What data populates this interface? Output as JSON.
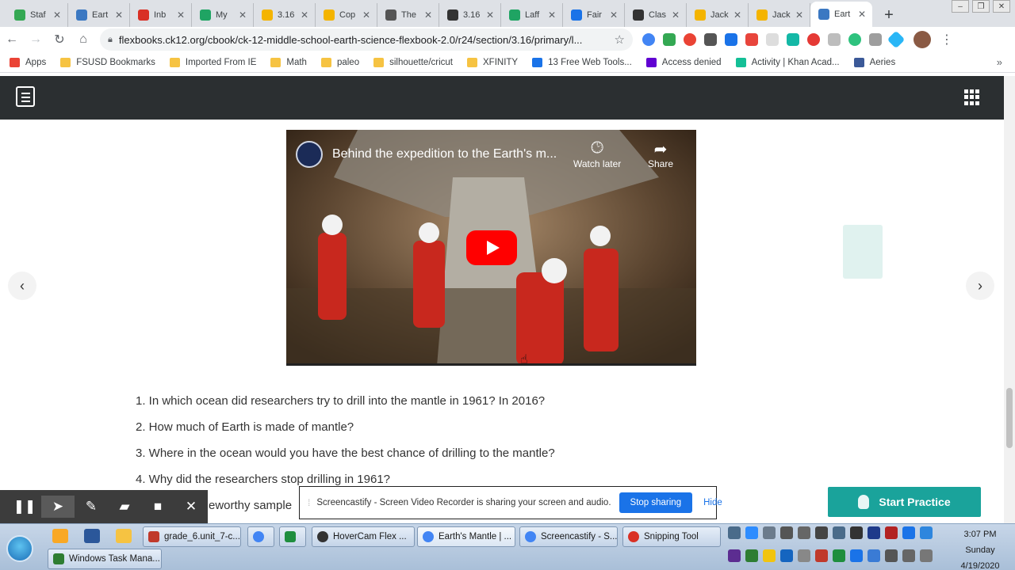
{
  "tabs": [
    {
      "label": "Staf",
      "icon": "green-dot-icon",
      "color": "#34a853"
    },
    {
      "label": "Eart",
      "icon": "book-icon",
      "color": "#3b78c2"
    },
    {
      "label": "Inb",
      "icon": "gmail-icon",
      "color": "#d93025"
    },
    {
      "label": "My",
      "icon": "drive-icon",
      "color": "#1fa463"
    },
    {
      "label": "3.16",
      "icon": "slides-icon",
      "color": "#f4b400"
    },
    {
      "label": "Cop",
      "icon": "slides-icon",
      "color": "#f4b400"
    },
    {
      "label": "The",
      "icon": "pencil-icon",
      "color": "#555555"
    },
    {
      "label": "3.16",
      "icon": "doc-icon",
      "color": "#333333"
    },
    {
      "label": "Laff",
      "icon": "drive-icon",
      "color": "#1fa463"
    },
    {
      "label": "Fair",
      "icon": "calendar-icon",
      "color": "#1a73e8"
    },
    {
      "label": "Clas",
      "icon": "doc-icon",
      "color": "#333333"
    },
    {
      "label": "Jack",
      "icon": "slides-icon",
      "color": "#f4b400"
    },
    {
      "label": "Jack",
      "icon": "slides-icon",
      "color": "#f4b400"
    },
    {
      "label": "Eart",
      "icon": "book-icon",
      "color": "#3b78c2",
      "active": true
    }
  ],
  "toolbar": {
    "url": "flexbooks.ck12.org/cbook/ck-12-middle-school-earth-science-flexbook-2.0/r24/section/3.16/primary/l..."
  },
  "bookmarks": [
    {
      "label": "Apps",
      "icon": "apps-grid-icon"
    },
    {
      "label": "FSUSD Bookmarks",
      "icon": "folder-icon"
    },
    {
      "label": "Imported From IE",
      "icon": "folder-icon"
    },
    {
      "label": "Math",
      "icon": "folder-icon"
    },
    {
      "label": "paleo",
      "icon": "folder-icon"
    },
    {
      "label": "silhouette/cricut",
      "icon": "folder-icon"
    },
    {
      "label": "XFINITY",
      "icon": "folder-icon"
    },
    {
      "label": "13 Free Web Tools...",
      "icon": "search-icon"
    },
    {
      "label": "Access denied",
      "icon": "yahoo-icon"
    },
    {
      "label": "Activity | Khan Acad...",
      "icon": "khan-icon"
    },
    {
      "label": "Aeries",
      "icon": "aeries-icon"
    }
  ],
  "video": {
    "title": "Behind the expedition to the Earth's m...",
    "watch_later": "Watch later",
    "share": "Share"
  },
  "questions": [
    "1. In which ocean did researchers try to drill into the mantle in 1961? In 2016?",
    "2. How much of Earth is made of mantle?",
    "3. Where in the ocean would you have the best chance of drilling to the mantle?",
    "4. Why did the researchers stop drilling in 1961?",
    "eworthy sample"
  ],
  "share_bar": {
    "message": "Screencastify - Screen Video Recorder is sharing your screen and audio.",
    "stop_label": "Stop sharing",
    "hide_label": "Hide"
  },
  "start_practice": "Start Practice",
  "taskbar": {
    "buttons": [
      {
        "label": "grade_6.unit_7-c...",
        "color": "#c0392b"
      },
      {
        "label": "",
        "color": "#4285f4"
      },
      {
        "label": "",
        "color": "#1e8e3e"
      },
      {
        "label": "HoverCam Flex ...",
        "color": "#333333"
      },
      {
        "label": "Earth's Mantle | ...",
        "color": "#4285f4"
      },
      {
        "label": "Screencastify - S...",
        "color": "#4285f4"
      },
      {
        "label": "Snipping Tool",
        "color": "#d93025"
      },
      {
        "label": "Windows Task Mana...",
        "color": "#2e7d32"
      }
    ],
    "time": "3:07 PM",
    "day": "Sunday",
    "date": "4/19/2020"
  }
}
